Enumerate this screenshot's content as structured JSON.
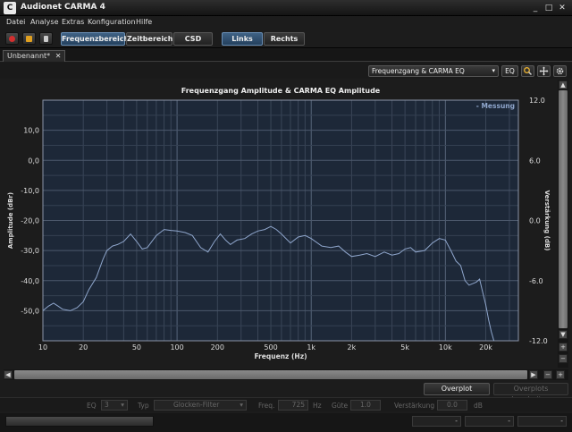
{
  "window": {
    "title": "Audionet CARMA 4",
    "app_icon": "C",
    "minimize": "_",
    "maximize": "□",
    "close": "✕"
  },
  "menu": [
    "Datei",
    "Analyse",
    "Extras",
    "Konfiguration",
    "Hilfe"
  ],
  "toolbar": {
    "icons": [
      {
        "name": "record-icon",
        "color": "#d32f2f"
      },
      {
        "name": "open-folder-icon",
        "color": "#e0a020"
      },
      {
        "name": "speaker-icon",
        "color": "#cccccc"
      }
    ],
    "view_buttons": [
      "Frequenzbereich",
      "Zeitbereich",
      "CSD"
    ],
    "active_view": "Frequenzbereich",
    "channel_buttons": [
      "Links",
      "Rechts"
    ],
    "active_channel": "Links"
  },
  "document_tab": {
    "label": "Unbenannt*",
    "close": "✕"
  },
  "chart_toolbar": {
    "select_value": "Frequenzgang & CARMA EQ",
    "eq_label": "EQ"
  },
  "chart_data": {
    "type": "line",
    "title": "Frequenzgang Amplitude & CARMA EQ Amplitude",
    "xlabel": "Frequenz (Hz)",
    "ylabel_left": "Amplitude (dBr)",
    "ylabel_right": "Verstärkung (dB)",
    "x_scale": "log",
    "xlim": [
      10,
      35000
    ],
    "ylim_left": [
      -60,
      20
    ],
    "ylim_right": [
      -12,
      12
    ],
    "x_ticks": [
      10,
      20,
      50,
      100,
      200,
      500,
      1000,
      2000,
      5000,
      10000,
      20000
    ],
    "x_tick_labels": [
      "10",
      "20",
      "50",
      "100",
      "200",
      "500",
      "1k",
      "2k",
      "5k",
      "10k",
      "20k"
    ],
    "y_ticks_left": [
      10,
      0,
      -10,
      -20,
      -30,
      -40,
      -50
    ],
    "y_tick_labels_left": [
      "10,0",
      "0,0",
      "-10,0",
      "-20,0",
      "-30,0",
      "-40,0",
      "-50,0"
    ],
    "y_ticks_right": [
      12,
      6,
      0,
      -6,
      -12
    ],
    "y_tick_labels_right": [
      "12.0",
      "6.0",
      "0.0",
      "-6.0",
      "-12.0"
    ],
    "grid": true,
    "legend": {
      "position": "top-right",
      "entries": [
        "- Messung"
      ]
    },
    "series": [
      {
        "name": "Messung",
        "color": "#8fa6cc",
        "x": [
          10,
          11,
          12,
          13,
          14,
          16,
          18,
          20,
          22,
          25,
          28,
          30,
          33,
          36,
          40,
          45,
          50,
          55,
          60,
          70,
          80,
          90,
          100,
          115,
          130,
          150,
          170,
          190,
          210,
          230,
          250,
          280,
          320,
          360,
          400,
          450,
          500,
          550,
          600,
          700,
          800,
          900,
          1000,
          1200,
          1400,
          1600,
          1800,
          2000,
          2300,
          2600,
          3000,
          3500,
          4000,
          4500,
          5000,
          5500,
          6000,
          7000,
          8000,
          9000,
          10000,
          11000,
          12000,
          13000,
          14000,
          15000,
          16000,
          17000,
          18000,
          19000,
          20000,
          21000,
          22000,
          23000
        ],
        "y": [
          -50.0,
          -48.5,
          -47.5,
          -48.5,
          -49.5,
          -50.0,
          -49.0,
          -47.0,
          -43.0,
          -39.0,
          -33.0,
          -30.0,
          -28.5,
          -28.0,
          -27.0,
          -24.5,
          -27.0,
          -29.5,
          -29.0,
          -25.0,
          -23.0,
          -23.3,
          -23.5,
          -24.0,
          -25.0,
          -29.0,
          -30.5,
          -27.0,
          -24.5,
          -26.5,
          -28.0,
          -26.5,
          -26.0,
          -24.5,
          -23.5,
          -23.0,
          -22.0,
          -23.0,
          -24.5,
          -27.5,
          -25.5,
          -25.0,
          -26.0,
          -28.5,
          -29.0,
          -28.5,
          -30.5,
          -32.0,
          -31.5,
          -31.0,
          -32.0,
          -30.5,
          -31.5,
          -31.0,
          -29.5,
          -29.0,
          -30.5,
          -30.0,
          -27.5,
          -26.0,
          -26.5,
          -30.0,
          -33.5,
          -35.0,
          -40.0,
          -41.5,
          -41.0,
          -40.5,
          -39.5,
          -44.0,
          -48.0,
          -53.0,
          -57.0,
          -60.0
        ]
      }
    ]
  },
  "bottom_buttons": {
    "create_overplot": "Overplot erzeugen",
    "edit_overplots": "Overplots bearbeiten"
  },
  "params": {
    "eq_label": "EQ",
    "eq_value": "3",
    "type_label": "Typ",
    "type_value": "Glocken-Filter",
    "freq_label": "Freq.",
    "freq_value": "725",
    "freq_unit": "Hz",
    "q_label": "Güte",
    "q_value": "1.0",
    "gain_label": "Verstärkung",
    "gain_value": "0.0",
    "gain_unit": "dB"
  },
  "status": {
    "field1": "-",
    "field2": "-",
    "field3": "-"
  }
}
